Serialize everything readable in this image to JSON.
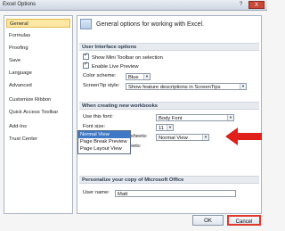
{
  "window": {
    "title": "Excel Options",
    "help_label": "?",
    "close_label": "X"
  },
  "sidebar": {
    "items": [
      {
        "label": "General"
      },
      {
        "label": "Formulas"
      },
      {
        "label": "Proofing"
      },
      {
        "label": "Save"
      },
      {
        "label": "Language"
      },
      {
        "label": "Advanced"
      },
      {
        "label": "Customize Ribbon"
      },
      {
        "label": "Quick Access Toolbar"
      },
      {
        "label": "Add-Ins"
      },
      {
        "label": "Trust Center"
      }
    ]
  },
  "panel": {
    "header": "General options for working with Excel.",
    "ui_section": "User Interface options",
    "show_mini_toolbar": "Show Mini Toolbar on selection",
    "enable_live_preview": "Enable Live Preview",
    "color_scheme_label": "Color scheme:",
    "color_scheme_value": "Blue",
    "screentip_label": "ScreenTip style:",
    "screentip_value": "Show feature descriptions in ScreenTips",
    "workbook_section": "When creating new workbooks",
    "font_label": "Use this font:",
    "font_value": "Body Font",
    "font_size_label": "Font size:",
    "font_size_value": "11",
    "default_view_label": "Default view for new sheets:",
    "default_view_value": "Normal View",
    "sheets_label": "Include this many sheets:",
    "personalize_section": "Personalize your copy of Microsoft Office",
    "username_label": "User name:",
    "username_value": "Matt",
    "dropdown_options": [
      "Normal View",
      "Page Break Preview",
      "Page Layout View"
    ]
  },
  "buttons": {
    "ok": "OK",
    "cancel": "Cancel"
  },
  "colors": {
    "accent": "#fbe7a3",
    "highlight": "#e0382a",
    "selection": "#3e78c6"
  }
}
